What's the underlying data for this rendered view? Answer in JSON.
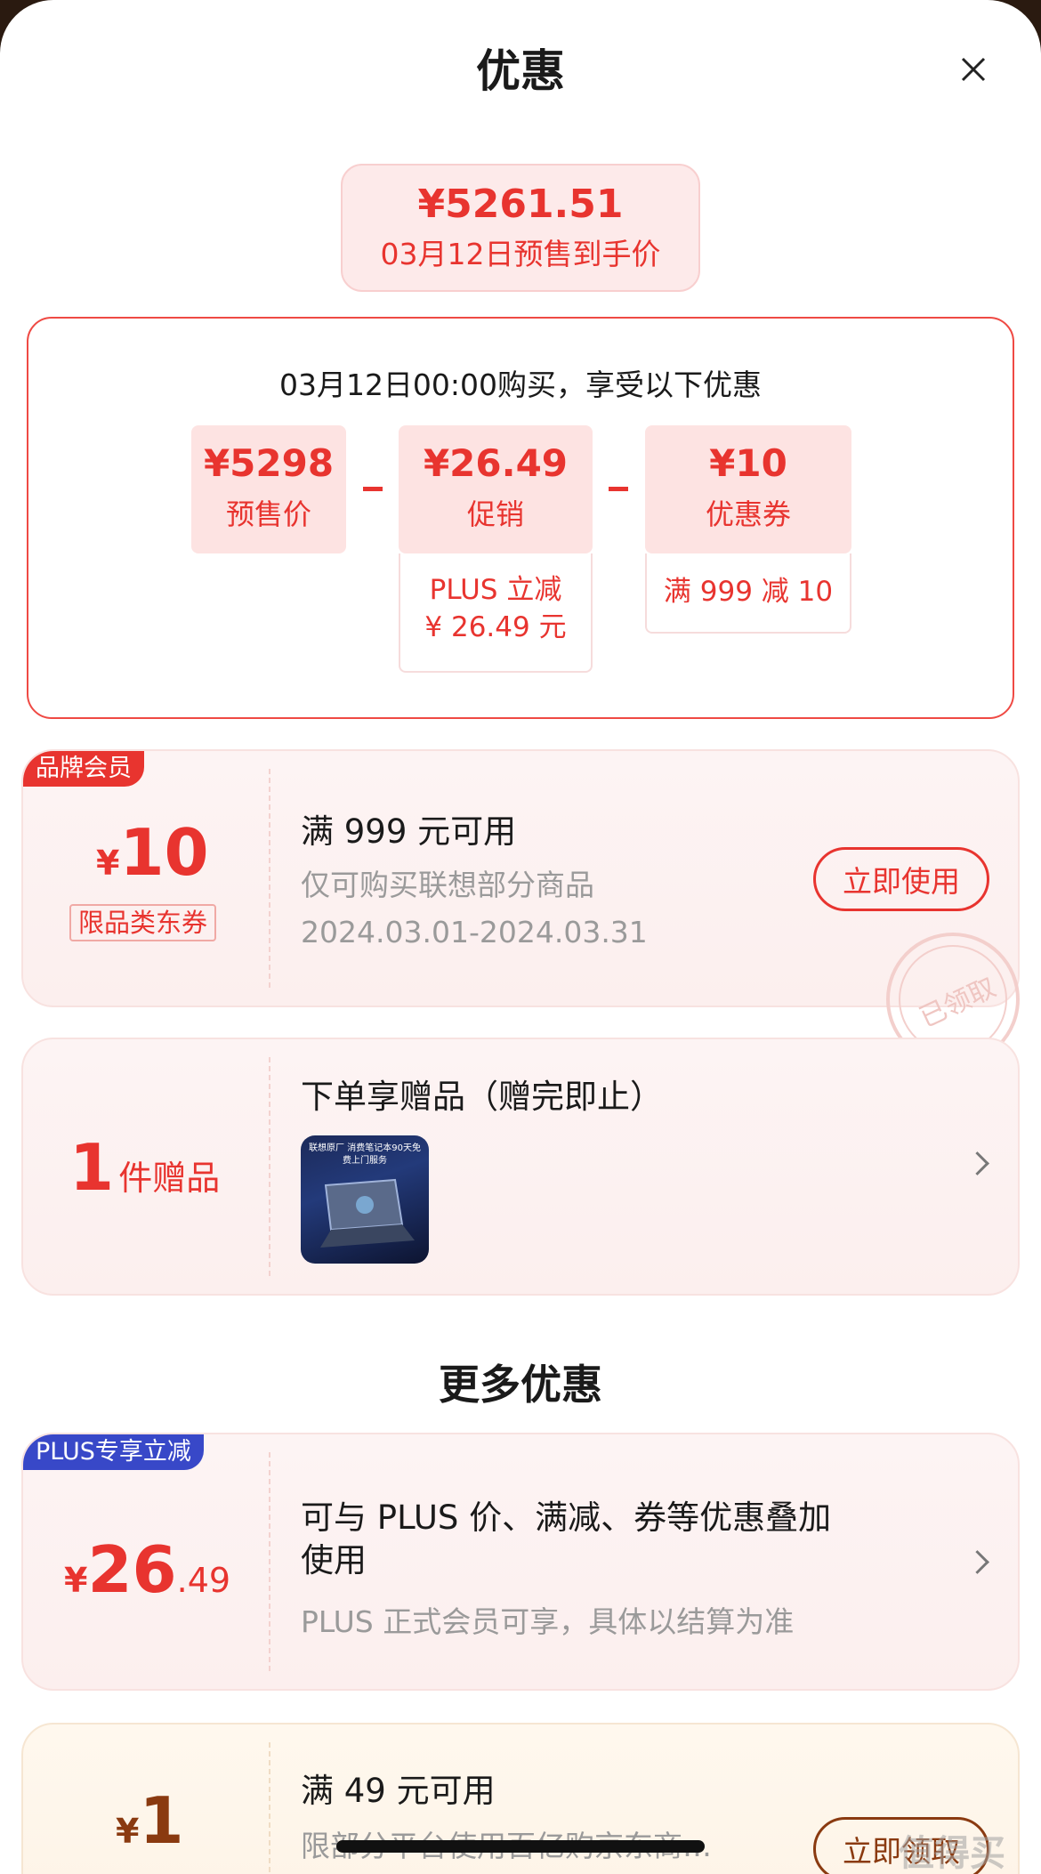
{
  "header": {
    "title": "优惠"
  },
  "summary": {
    "price": "¥5261.51",
    "subtitle": "03月12日预售到手价"
  },
  "calc": {
    "heading": "03月12日00:00购买，享受以下优惠",
    "items": [
      {
        "amount": "¥5298",
        "label": "预售价"
      },
      {
        "amount": "¥26.49",
        "label": "促销",
        "detail_line1": "PLUS 立减",
        "detail_line2": "¥ 26.49 元"
      },
      {
        "amount": "¥10",
        "label": "优惠券",
        "detail_line1": "满 999 减 10"
      }
    ]
  },
  "coupon1": {
    "tag": "品牌会员",
    "currency": "¥",
    "value": "10",
    "type_label": "限品类东券",
    "title": "满 999 元可用",
    "desc": "仅可购买联想部分商品",
    "dates": "2024.03.01-2024.03.31",
    "button": "立即使用",
    "stamp": "已领取"
  },
  "gift": {
    "count": "1",
    "unit": "件赠品",
    "title": "下单享赠品（赠完即止）",
    "image_caption": "联想原厂 消费笔记本90天免费上门服务"
  },
  "more": {
    "title": "更多优惠"
  },
  "plus": {
    "tag": "PLUS专享立减",
    "currency": "¥",
    "value_int": "26",
    "value_dec": ".49",
    "line1": "可与 PLUS 价、满减、券等优惠叠加",
    "line2": "使用",
    "desc": "PLUS 正式会员可享，具体以结算为准"
  },
  "coupon2": {
    "currency": "¥",
    "value": "1",
    "title": "满 49 元可用",
    "desc": "限部分平台使用百亿购京东商…",
    "button": "立即领取"
  },
  "watermark": "值得买",
  "colors": {
    "accent": "#e8342f",
    "plus_blue": "#3848c8"
  }
}
